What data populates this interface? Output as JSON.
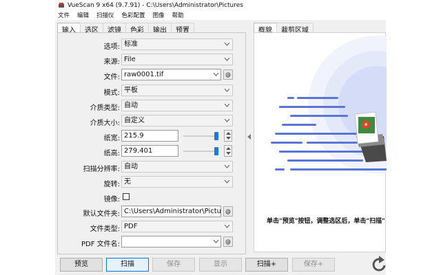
{
  "window": {
    "title": "VueScan 9 x64 (9.7.91) - C:\\Users\\Administrator\\Pictures"
  },
  "menu": [
    "文件",
    "编辑",
    "扫描仪",
    "色彩配置",
    "图像",
    "帮助"
  ],
  "left_tabs": [
    "输入",
    "选区",
    "滤镜",
    "色彩",
    "输出",
    "预置"
  ],
  "right_tabs": [
    "概貌",
    "裁剪区域"
  ],
  "fields": {
    "option": {
      "label": "选项:",
      "value": "标准"
    },
    "source": {
      "label": "来源:",
      "value": "File"
    },
    "file": {
      "label": "文件:",
      "value": "raw0001.tif"
    },
    "mode": {
      "label": "模式:",
      "value": "平板"
    },
    "media_type": {
      "label": "介质类型:",
      "value": "自动"
    },
    "media_size": {
      "label": "介质大小:",
      "value": "自定义"
    },
    "paper_width": {
      "label": "纸宽:",
      "value": "215.9",
      "slider_fraction": 0.92
    },
    "paper_height": {
      "label": "纸高:",
      "value": "279.401",
      "slider_fraction": 0.92
    },
    "scan_resolution": {
      "label": "扫描分辨率:",
      "value": "自动"
    },
    "rotation": {
      "label": "旋转:",
      "value": "无"
    },
    "mirror": {
      "label": "镜像:",
      "checked": false
    },
    "default_folder": {
      "label": "默认文件夹:",
      "value": "C:\\Users\\Administrator\\Pictu"
    },
    "file_type": {
      "label": "文件类型:",
      "value": "PDF"
    },
    "pdf_filename": {
      "label": "PDF 文件名:",
      "value": ""
    }
  },
  "browse_symbol": "@",
  "preview": {
    "hint": "单击\"预览\"按钮，调整选区后，单击\"扫描\""
  },
  "buttons": {
    "preview": "预览",
    "scan": "扫描",
    "save": "保存",
    "display": "显示",
    "scan_plus": "扫描+",
    "save_plus": "保存+"
  },
  "colors": {
    "accent": "#1f7ad6",
    "illustration_blue": "#5b74d6"
  },
  "icons": {
    "app": "vuescan-app-icon",
    "refresh": "refresh-icon"
  }
}
